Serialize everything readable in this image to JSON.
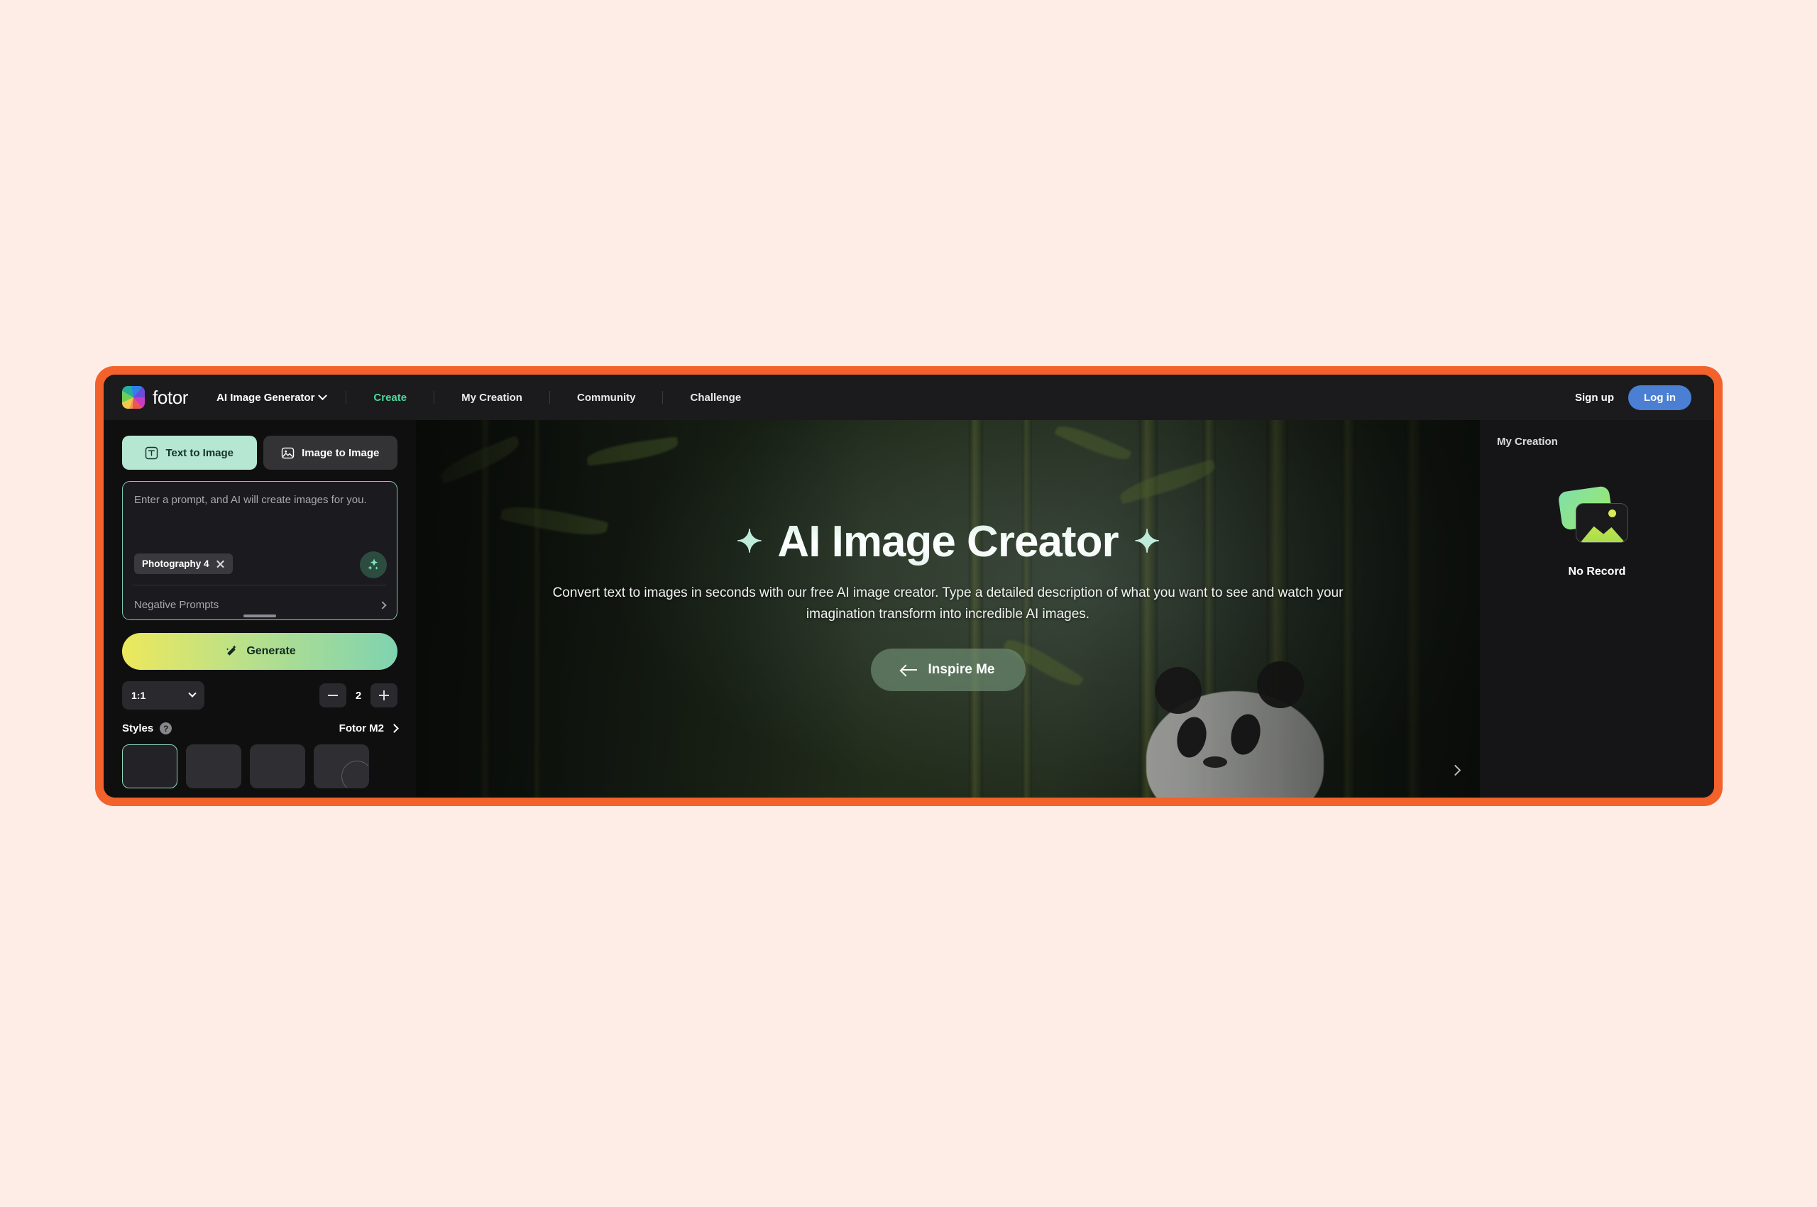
{
  "theme": {
    "frame_color": "#F2622A",
    "page_bg": "#FDEDE6",
    "app_bg": "#0F0F10",
    "accent_green": "#4ED69A",
    "login_blue": "#4A7FD4",
    "mint": "#B6E7D2"
  },
  "topnav": {
    "brand": "fotor",
    "product_menu": "AI Image Generator",
    "links": [
      {
        "label": "Create",
        "active": true
      },
      {
        "label": "My Creation",
        "active": false
      },
      {
        "label": "Community",
        "active": false
      },
      {
        "label": "Challenge",
        "active": false
      }
    ],
    "signup_label": "Sign up",
    "login_label": "Log in"
  },
  "left_panel": {
    "tabs": [
      {
        "label": "Text to Image",
        "active": true,
        "icon": "text-icon"
      },
      {
        "label": "Image to Image",
        "active": false,
        "icon": "image-icon"
      }
    ],
    "prompt_placeholder": "Enter a prompt, and AI will create images for you.",
    "prompt_value": "",
    "chip": {
      "label": "Photography 4",
      "remove": "×"
    },
    "enhance_icon": "sparkles-icon",
    "negative_prompts_label": "Negative Prompts",
    "generate_label": "Generate",
    "ratio_value": "1:1",
    "count_value": "2",
    "decrement_label": "−",
    "increment_label": "+",
    "styles_label": "Styles",
    "styles_help": "?",
    "styles_model": "Fotor M2",
    "style_thumbs": [
      {
        "selected": true
      },
      {
        "selected": false
      },
      {
        "selected": false
      },
      {
        "selected": false
      }
    ]
  },
  "hero": {
    "title": "AI Image Creator",
    "sparkle_left": "✦",
    "sparkle_right": "✦",
    "subtitle": "Convert text to images in seconds with our free AI image creator. Type a detailed description of what you want to see and watch your imagination transform into incredible AI images.",
    "cta_label": "Inspire Me",
    "next_icon": "chevron-right-icon"
  },
  "right_panel": {
    "title": "My Creation",
    "empty_text": "No Record"
  }
}
